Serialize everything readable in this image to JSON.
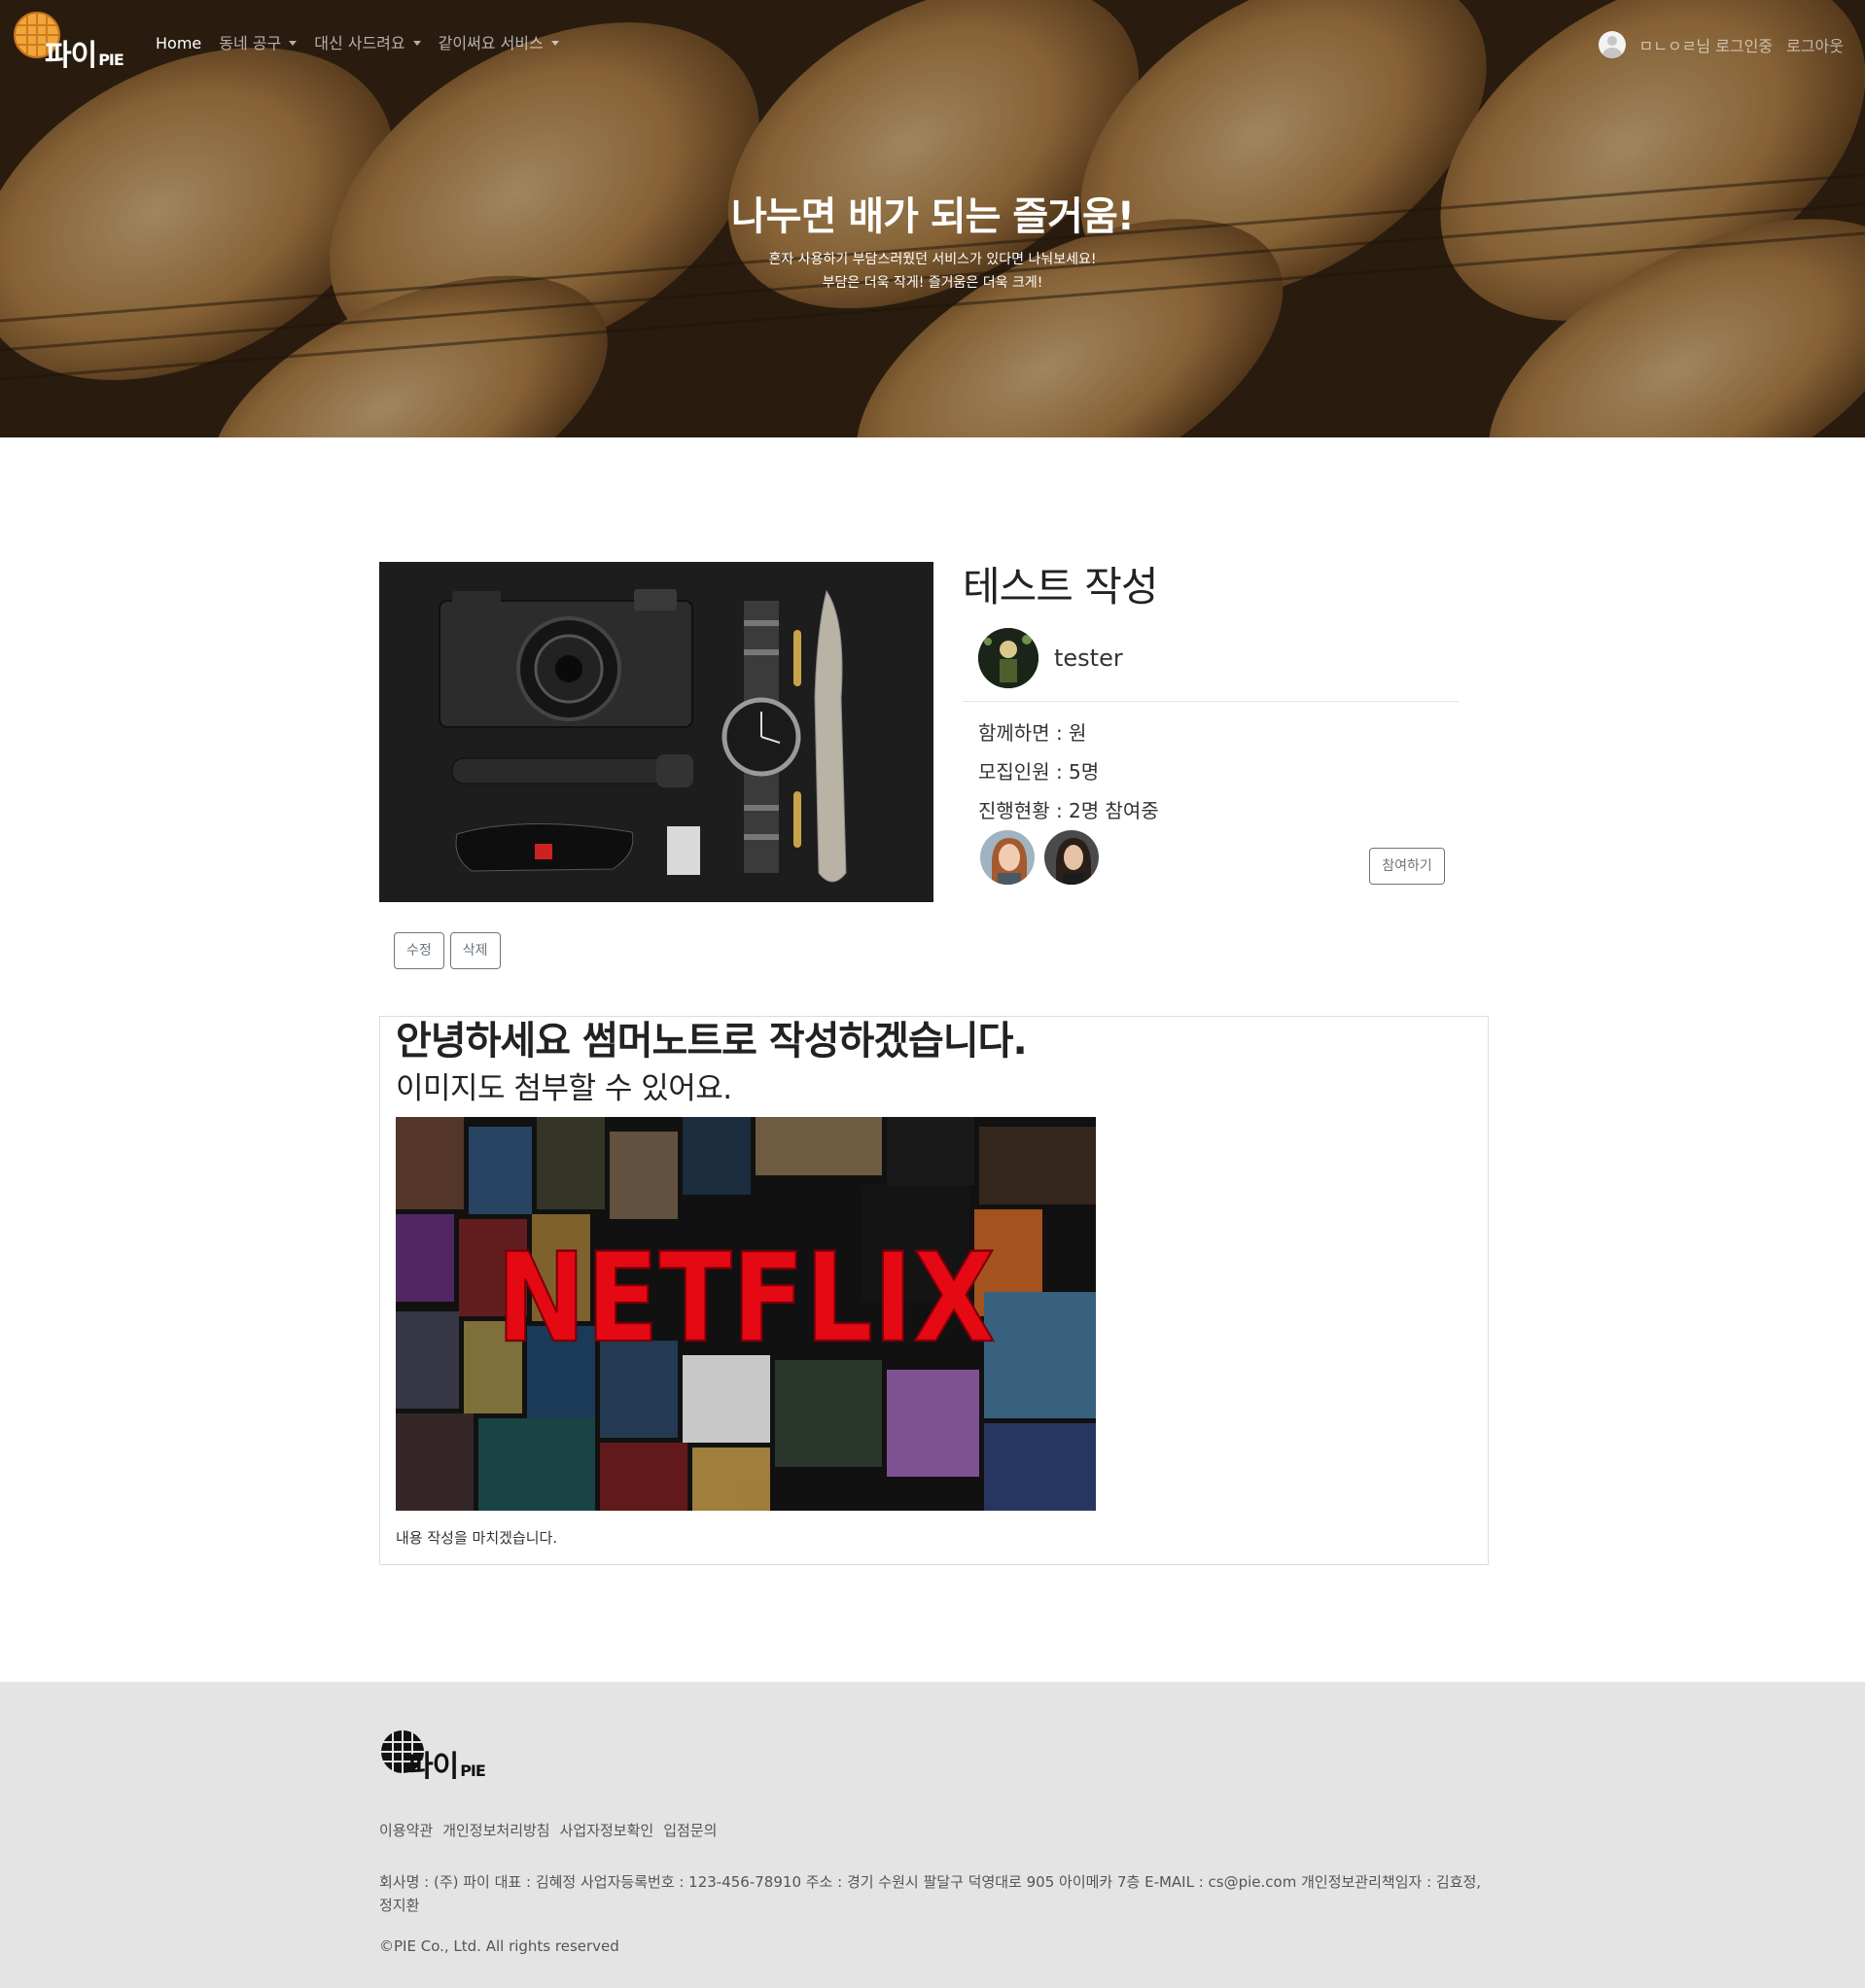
{
  "brand": {
    "logo_text": "파이",
    "logo_sub": "PIE"
  },
  "nav": {
    "home": "Home",
    "group_buy": "동네 공구",
    "errand": "대신 사드려요",
    "share_service": "같이써요 서비스",
    "user_status": "ㅁㄴㅇㄹ님 로그인중",
    "logout": "로그아웃"
  },
  "hero": {
    "title": "나누면 배가 되는 즐거움!",
    "subtitle_1": "혼자 사용하기 부담스러웠던 서비스가 있다면 나눠보세요!",
    "subtitle_2": "부담은 더욱 작게! 즐거움은 더욱 크게!"
  },
  "post": {
    "title": "테스트 작성",
    "author": "tester",
    "price": "함께하면 : 원",
    "capacity": "모집인원 : 5명",
    "progress": "진행현황 : 2명 참여중",
    "join_label": "참여하기",
    "edit_label": "수정",
    "delete_label": "삭제"
  },
  "content": {
    "heading": "안녕하세요 썸머노트로 작성하겠습니다.",
    "subheading": "이미지도 첨부할 수 있어요.",
    "image_text": "NETFLIX",
    "closing": "내용 작성을 마치겠습니다."
  },
  "footer": {
    "links": [
      "이용약관",
      "개인정보처리방침",
      "사업자정보확인",
      "입점문의"
    ],
    "company_info": "회사명 : (주) 파이 대표 : 김혜정 사업자등록번호 : 123-456-78910 주소 : 경기 수원시 팔달구 덕영대로 905 아이메카 7층 E-MAIL : cs@pie.com 개인정보관리책임자 : 김효정, 정지환",
    "copyright": "©PIE Co., Ltd. All rights reserved"
  },
  "colors": {
    "netflix_red": "#e50914",
    "footer_bg": "#e4e4e4",
    "button_outline": "#6c757d"
  }
}
